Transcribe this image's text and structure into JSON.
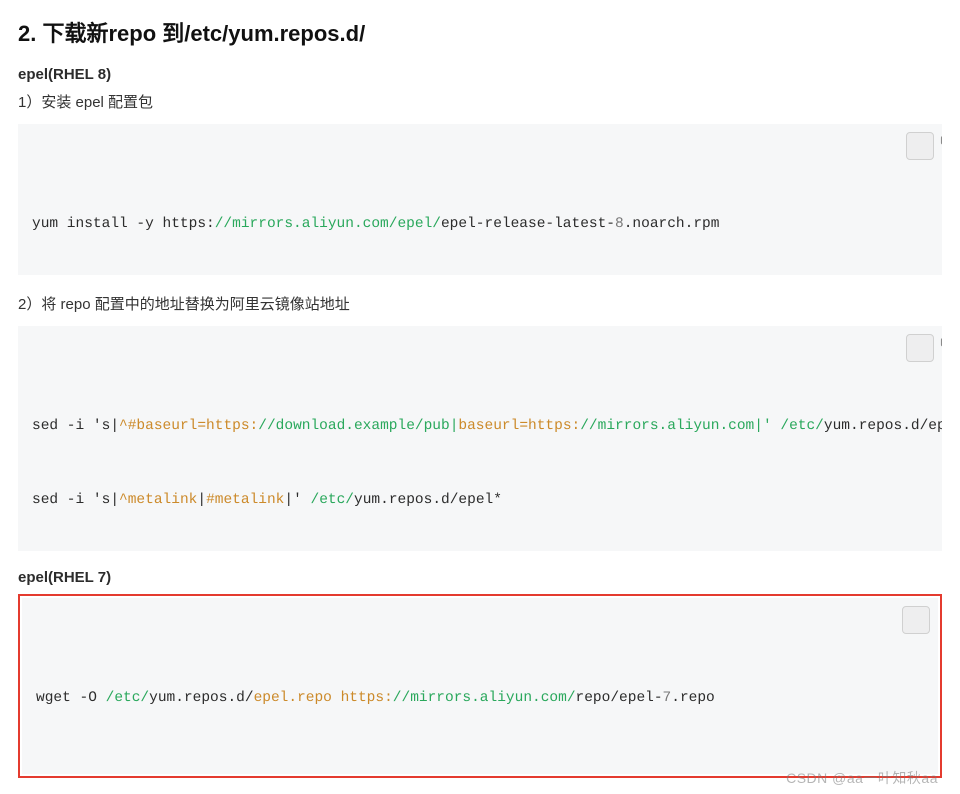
{
  "heading": "2. 下载新repo 到/etc/yum.repos.d/",
  "sections": {
    "rhel8": {
      "title": "epel(RHEL 8)",
      "step1_label": "1）安装 epel 配置包",
      "code1": {
        "parts": [
          {
            "t": "yum install -y https:"
          },
          {
            "t": "//mirrors.aliyun.com/epel/",
            "cls": "tok-g"
          },
          {
            "t": "epel-release-latest-"
          },
          {
            "t": "8",
            "cls": "tok-n"
          },
          {
            "t": ".noarch.rpm"
          }
        ]
      },
      "step2_label": "2）将 repo 配置中的地址替换为阿里云镜像站地址",
      "code2_line1": {
        "parts": [
          {
            "t": "sed -i "
          },
          {
            "t": "'s|"
          },
          {
            "t": "^#baseurl=https:",
            "cls": "tok-o"
          },
          {
            "t": "//download.example/pub|",
            "cls": "tok-g"
          },
          {
            "t": "baseurl=https:",
            "cls": "tok-o"
          },
          {
            "t": "//mirrors.aliyun.com|' ",
            "cls": "tok-g"
          },
          {
            "t": "/etc/",
            "cls": "tok-g"
          },
          {
            "t": "yum.repos.d/epel*                    "
          }
        ]
      },
      "code2_line2": {
        "parts": [
          {
            "t": "sed -i "
          },
          {
            "t": "'s|"
          },
          {
            "t": "^metalink",
            "cls": "tok-o"
          },
          {
            "t": "|"
          },
          {
            "t": "#metalink",
            "cls": "tok-o"
          },
          {
            "t": "|' "
          },
          {
            "t": "/etc/",
            "cls": "tok-g"
          },
          {
            "t": "yum.repos.d/epel*"
          }
        ]
      }
    },
    "rhel7": {
      "title": "epel(RHEL 7)",
      "code": {
        "parts": [
          {
            "t": "wget -O "
          },
          {
            "t": "/etc/",
            "cls": "tok-g"
          },
          {
            "t": "yum.repos.d/"
          },
          {
            "t": "epel.repo https:",
            "cls": "tok-o"
          },
          {
            "t": "//mirrors.aliyun.com/",
            "cls": "tok-g"
          },
          {
            "t": "repo/epel-"
          },
          {
            "t": "7",
            "cls": "tok-n"
          },
          {
            "t": ".repo"
          }
        ]
      }
    }
  },
  "watermark": "CSDN @aa一叶知秋aa",
  "icons": {
    "copy": "copy-icon"
  }
}
